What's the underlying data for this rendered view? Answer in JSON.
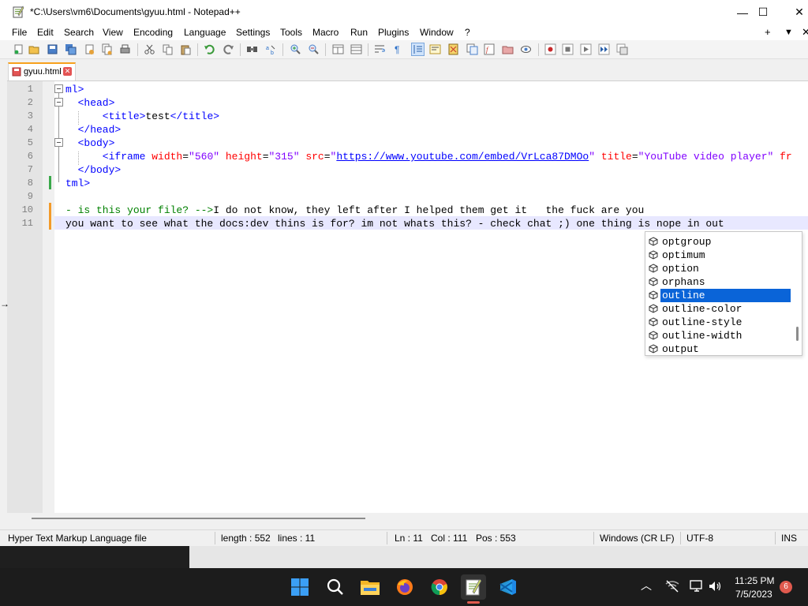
{
  "window": {
    "title": "*C:\\Users\\vm6\\Documents\\gyuu.html - Notepad++",
    "minimize": "—",
    "maximize": "☐",
    "close": "✕"
  },
  "menu": {
    "items": [
      "File",
      "Edit",
      "Search",
      "View",
      "Encoding",
      "Language",
      "Settings",
      "Tools",
      "Macro",
      "Run",
      "Plugins",
      "Window",
      "?"
    ],
    "right": [
      "+",
      "▼",
      "✕"
    ]
  },
  "tab": {
    "label": "gyuu.html",
    "close": "✕"
  },
  "editor": {
    "line_numbers": [
      "1",
      "2",
      "3",
      "4",
      "5",
      "6",
      "7",
      "8",
      "9",
      "10",
      "11"
    ],
    "lines": [
      [
        {
          "t": "tag",
          "s": "ml>"
        }
      ],
      [
        {
          "t": "tag",
          "s": "  <head>"
        }
      ],
      [
        {
          "t": "tag",
          "s": "      <title>"
        },
        {
          "t": "text",
          "s": "test"
        },
        {
          "t": "tag",
          "s": "</title>"
        }
      ],
      [
        {
          "t": "tag",
          "s": "  </head>"
        }
      ],
      [
        {
          "t": "tag",
          "s": "  <body>"
        }
      ],
      [
        {
          "t": "tag",
          "s": "      <iframe "
        },
        {
          "t": "attr",
          "s": "width"
        },
        {
          "t": "text",
          "s": "="
        },
        {
          "t": "val",
          "s": "\"560\""
        },
        {
          "t": "text",
          "s": " "
        },
        {
          "t": "attr",
          "s": "height"
        },
        {
          "t": "text",
          "s": "="
        },
        {
          "t": "val",
          "s": "\"315\""
        },
        {
          "t": "text",
          "s": " "
        },
        {
          "t": "attr",
          "s": "src"
        },
        {
          "t": "text",
          "s": "="
        },
        {
          "t": "val",
          "s": "\""
        },
        {
          "t": "url",
          "s": "https://www.youtube.com/embed/VrLca87DMOo"
        },
        {
          "t": "val",
          "s": "\""
        },
        {
          "t": "text",
          "s": " "
        },
        {
          "t": "attr",
          "s": "title"
        },
        {
          "t": "text",
          "s": "="
        },
        {
          "t": "val",
          "s": "\"YouTube video player\""
        },
        {
          "t": "text",
          "s": " "
        },
        {
          "t": "attr",
          "s": "fr"
        }
      ],
      [
        {
          "t": "tag",
          "s": "  </body>"
        }
      ],
      [
        {
          "t": "tag",
          "s": "tml>"
        }
      ],
      [
        {
          "t": "text",
          "s": ""
        }
      ],
      [
        {
          "t": "comment",
          "s": "- is this your file? -->"
        },
        {
          "t": "text",
          "s": "I do not know, they left after I helped them get it   the fuck are you"
        }
      ],
      [
        {
          "t": "text",
          "s": "you want to see what the docs:dev thins is for? im not whats this? - check chat ;) one thing is nope in out"
        }
      ]
    ]
  },
  "autocomplete": {
    "items": [
      "optgroup",
      "optimum",
      "option",
      "orphans",
      "outline",
      "outline-color",
      "outline-style",
      "outline-width",
      "output"
    ],
    "selected": "outline"
  },
  "status": {
    "file_type": "Hyper Text Markup Language file",
    "length": "length : 552",
    "lines": "lines : 11",
    "ln": "Ln : 11",
    "col": "Col : 111",
    "pos": "Pos : 553",
    "eol": "Windows (CR LF)",
    "encoding": "UTF-8",
    "mode": "INS"
  },
  "taskbar": {
    "time": "11:25 PM",
    "date": "7/5/2023",
    "notifications": "6",
    "tray_chevron": "︿"
  },
  "colors": {
    "tag": "#0000ff",
    "attr": "#ff0000",
    "value": "#8000ff",
    "comment": "#008000",
    "selection": "#0a64d8",
    "tab_accent": "#f7a11d"
  }
}
